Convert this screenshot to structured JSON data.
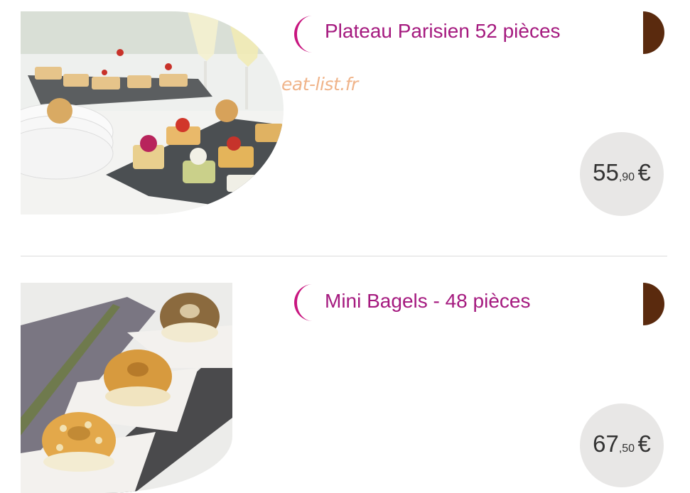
{
  "products": [
    {
      "name": "Plateau Parisien 52 pièces",
      "price": {
        "integer": "55",
        "decimals": ",90",
        "currency": "€"
      }
    },
    {
      "name": "Mini Bagels - 48 pièces",
      "price": {
        "integer": "67",
        "decimals": ",50",
        "currency": "€"
      }
    }
  ],
  "watermark": "eat-list.fr",
  "colors": {
    "title": "#a51a7f",
    "accent_moon": "#c8157f",
    "half_disc": "#5a2a0e",
    "price_bg": "#e8e7e6"
  }
}
